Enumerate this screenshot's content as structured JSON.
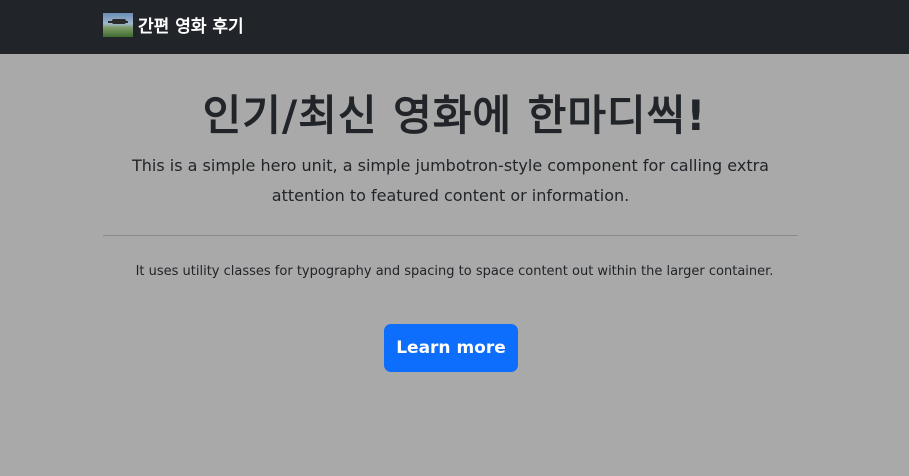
{
  "navbar": {
    "brand_text": "간편 영화 후기",
    "brand_logo_icon": "movie-thumbnail-logo"
  },
  "hero": {
    "title": "인기/최신 영화에 한마디씩!",
    "lead": "This is a simple hero unit, a simple jumbotron-style component for calling extra attention to featured content or information.",
    "body": "It uses utility classes for typography and spacing to space content out within the larger container.",
    "button_label": "Learn more"
  },
  "colors": {
    "navbar_bg": "#212529",
    "page_bg": "#a9a9a9",
    "primary_button": "#0d6efd",
    "text": "#212529"
  }
}
